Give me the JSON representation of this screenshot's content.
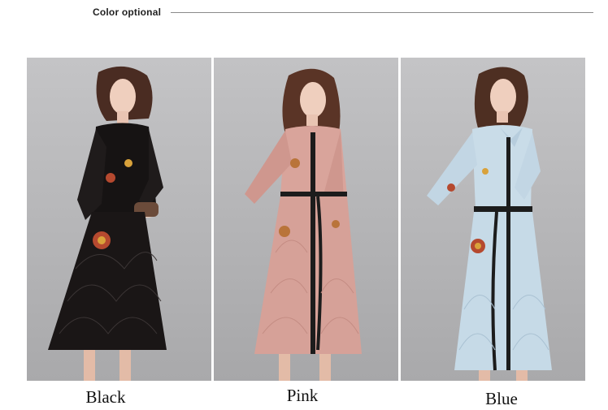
{
  "header": {
    "title": "Color optional"
  },
  "products": [
    {
      "caption": "Black",
      "dress_color": "#161313",
      "accent": "#b5492f"
    },
    {
      "caption": "Pink",
      "dress_color": "#d9a49b",
      "accent": "#1c1c1c"
    },
    {
      "caption": "Blue",
      "dress_color": "#c9dce8",
      "accent": "#1c1c1c"
    }
  ],
  "colors": {
    "background": "#ffffff",
    "photo_backdrop": "#b9b9bb",
    "header_line": "#8a8a8a"
  }
}
